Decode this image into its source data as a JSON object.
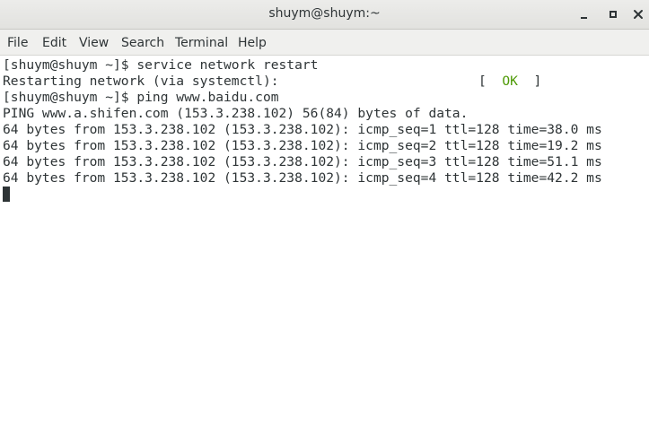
{
  "window": {
    "title": "shuym@shuym:~"
  },
  "menu": {
    "file": "File",
    "edit": "Edit",
    "view": "View",
    "search": "Search",
    "terminal": "Terminal",
    "help": "Help"
  },
  "terminal": {
    "lines": [
      "[shuym@shuym ~]$ service network restart",
      "Restarting network (via systemctl):",
      "[shuym@shuym ~]$ ping www.baidu.com",
      "PING www.a.shifen.com (153.3.238.102) 56(84) bytes of data.",
      "64 bytes from 153.3.238.102 (153.3.238.102): icmp_seq=1 ttl=128 time=38.0 ms",
      "64 bytes from 153.3.238.102 (153.3.238.102): icmp_seq=2 ttl=128 time=19.2 ms",
      "64 bytes from 153.3.238.102 (153.3.238.102): icmp_seq=3 ttl=128 time=51.1 ms",
      "64 bytes from 153.3.238.102 (153.3.238.102): icmp_seq=4 ttl=128 time=42.2 ms"
    ],
    "status": {
      "open_bracket": "[",
      "ok": "OK",
      "close_bracket": "]"
    }
  },
  "icons": {
    "minimize": "minimize-icon",
    "maximize": "maximize-icon",
    "close": "close-icon"
  },
  "colors": {
    "ok": "#4e9a06",
    "text": "#2e3436",
    "background": "#ffffff"
  }
}
